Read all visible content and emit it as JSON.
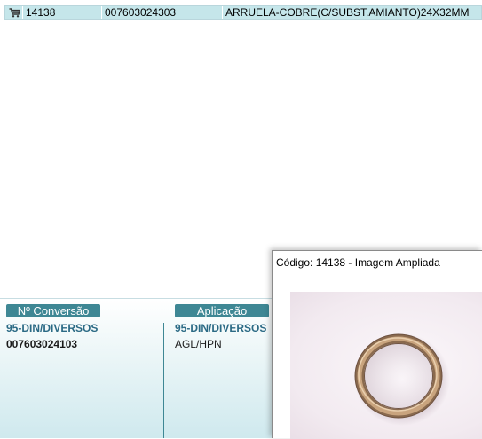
{
  "result": {
    "icon": "cart-icon",
    "code": "14138",
    "reference": "007603024303",
    "description": "ARRUELA-COBRE(C/SUBST.AMIANTO)24X32MM"
  },
  "info": {
    "conversion_header": "Nº Conversão",
    "conversion_group": "95-DIN/DIVERSOS",
    "conversion_value": "007603024103",
    "application_header": "Aplicação",
    "application_group": "95-DIN/DIVERSOS",
    "application_value": "AGL/HPN"
  },
  "image_window": {
    "title": "Código: 14138 - Imagem Ampliada"
  },
  "colors": {
    "row_highlight": "#c5e6ea",
    "header_pill": "#3e8794",
    "group_text": "#2b6a85"
  }
}
